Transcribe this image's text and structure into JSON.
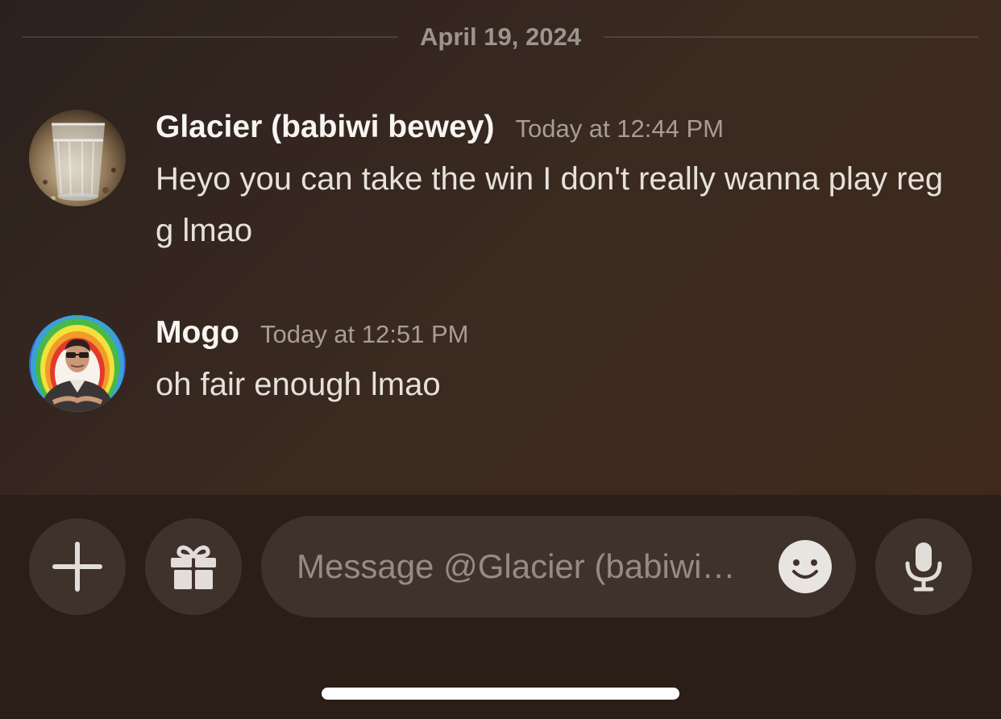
{
  "chat": {
    "date_divider": "April 19, 2024",
    "messages": [
      {
        "author": "Glacier (babiwi bewey)",
        "timestamp": "Today at 12:44 PM",
        "text": "Heyo you can take the win I don't really wanna play reg g lmao",
        "avatar_icon": "glass-of-water-photo"
      },
      {
        "author": "Mogo",
        "timestamp": "Today at 12:51 PM",
        "text": "oh fair enough lmao",
        "avatar_icon": "person-rainbow-outline-photo"
      }
    ]
  },
  "composer": {
    "placeholder": "Message @Glacier (babiwi…",
    "buttons": {
      "add_icon": "plus-icon",
      "gift_icon": "gift-icon",
      "emoji_icon": "smiley-icon",
      "voice_icon": "microphone-icon"
    }
  },
  "colors": {
    "background": "#3a2a20",
    "composer_bg": "#2b1e16",
    "button_bg": "#3f322b",
    "username": "#f7f4f1",
    "timestamp": "#a69d97",
    "message_text": "#e7e1dc"
  }
}
